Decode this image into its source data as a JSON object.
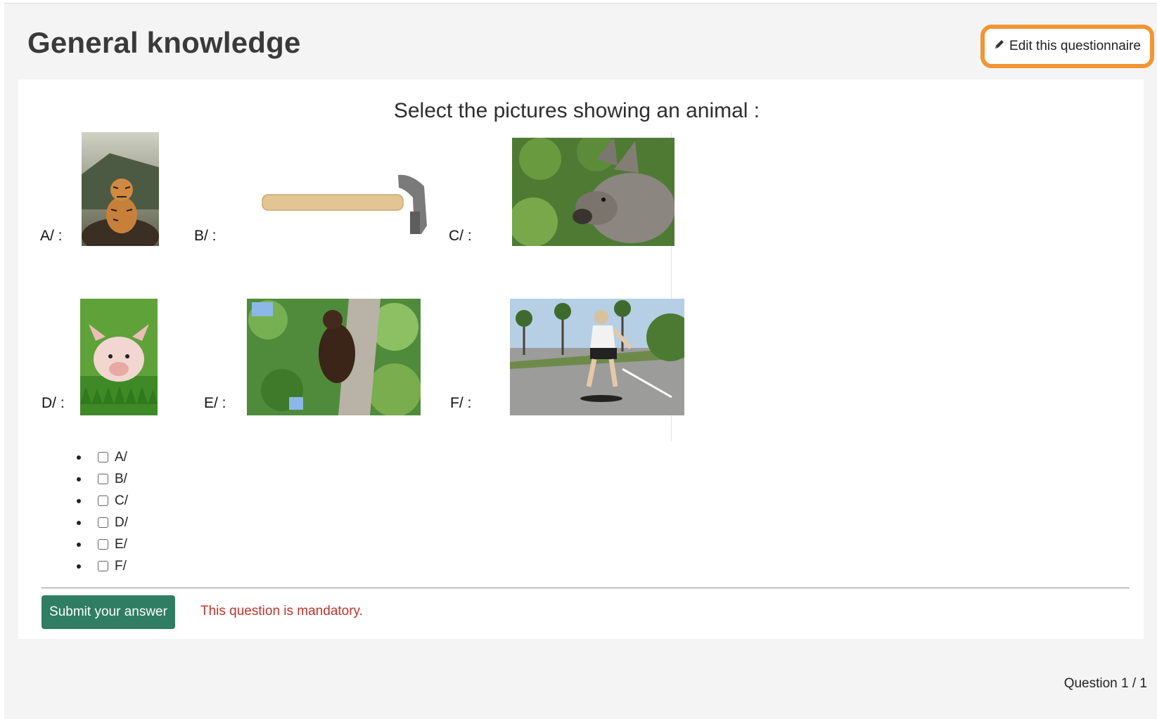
{
  "page": {
    "title": "General knowledge",
    "edit_button": "Edit this questionnaire",
    "counter": "Question 1 / 1"
  },
  "question": {
    "text": "Select the pictures showing an animal :",
    "options": [
      {
        "label": "A/ :",
        "picture": "tiger-cub"
      },
      {
        "label": "B/ :",
        "picture": "hammer"
      },
      {
        "label": "C/ :",
        "picture": "donkey"
      },
      {
        "label": "D/ :",
        "picture": "piglet"
      },
      {
        "label": "E/ :",
        "picture": "bear-cub-on-tree"
      },
      {
        "label": "F/ :",
        "picture": "skateboarder"
      }
    ],
    "choices": [
      "A/",
      "B/",
      "C/",
      "D/",
      "E/",
      "F/"
    ],
    "submit_label": "Submit your answer",
    "error_text": "This question is mandatory."
  },
  "icons": {
    "edit": "pencil-icon"
  },
  "colors": {
    "accent_border": "#f29533",
    "submit_bg": "#2f7d63",
    "error_text": "#c0332b"
  }
}
